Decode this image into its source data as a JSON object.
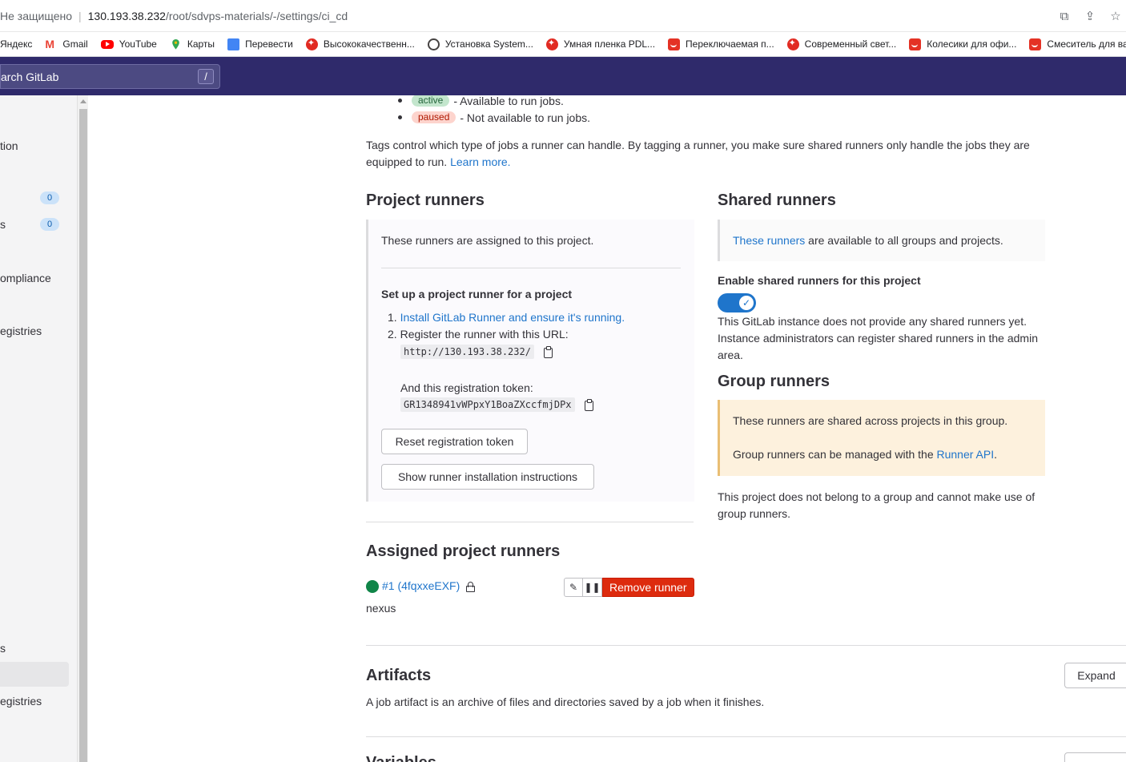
{
  "browser": {
    "secure_label": "Не защищено",
    "url_host": "130.193.38.232",
    "url_path": "/root/sdvps-materials/-/settings/ci_cd",
    "bookmarks": [
      {
        "label": "Яндекс",
        "icon": "yandex-icon"
      },
      {
        "label": "Gmail",
        "icon": "gmail-icon"
      },
      {
        "label": "YouTube",
        "icon": "youtube-icon"
      },
      {
        "label": "Карты",
        "icon": "maps-icon"
      },
      {
        "label": "Перевести",
        "icon": "translate-icon"
      },
      {
        "label": "Высококачественн...",
        "icon": "aliexpress-star-icon"
      },
      {
        "label": "Установка System...",
        "icon": "wordpress-icon"
      },
      {
        "label": "Умная пленка PDL...",
        "icon": "aliexpress-star-icon"
      },
      {
        "label": "Переключаемая п...",
        "icon": "aliexpress-bag-icon"
      },
      {
        "label": "Современный свет...",
        "icon": "aliexpress-star-icon"
      },
      {
        "label": "Колесики для офи...",
        "icon": "aliexpress-bag-icon"
      },
      {
        "label": "Смеситель для ва",
        "icon": "aliexpress-bag-icon"
      }
    ]
  },
  "header": {
    "search_placeholder": "arch GitLab",
    "search_shortcut": "/"
  },
  "sidebar": {
    "items": [
      {
        "label": "tion"
      },
      {
        "label": "",
        "count": "0"
      },
      {
        "label": "s",
        "count": "0"
      },
      {
        "label": "ompliance"
      },
      {
        "label": "egistries"
      },
      {
        "label": "s"
      },
      {
        "label": ""
      },
      {
        "label": "egistries"
      }
    ]
  },
  "main": {
    "statuses": [
      {
        "badge": "active",
        "text": "- Available to run jobs."
      },
      {
        "badge": "paused",
        "text": "- Not available to run jobs."
      }
    ],
    "tags_text": "Tags control which type of jobs a runner can handle. By tagging a runner, you make sure shared runners only handle the jobs they are equipped to run.",
    "learn_more": "Learn more.",
    "project_runners": {
      "title": "Project runners",
      "assigned_text": "These runners are assigned to this project.",
      "setup_title": "Set up a project runner for a project",
      "step1_link": "Install GitLab Runner and ensure it's running.",
      "step2_text": "Register the runner with this URL:",
      "url": "http://130.193.38.232/",
      "token_label": "And this registration token:",
      "token": "GR1348941vWPpxY1BoaZXccfmjDPx",
      "reset_button": "Reset registration token",
      "instructions_button": "Show runner installation instructions"
    },
    "shared_runners": {
      "title": "Shared runners",
      "link": "These runners",
      "text": "are available to all groups and projects.",
      "enable_label": "Enable shared runners for this project",
      "enabled": true,
      "note": "This GitLab instance does not provide any shared runners yet. Instance administrators can register shared runners in the admin area."
    },
    "group_runners": {
      "title": "Group runners",
      "shared_text": "These runners are shared across projects in this group.",
      "managed_text": "Group runners can be managed with the",
      "api_link": "Runner API",
      "note": "This project does not belong to a group and cannot make use of group runners."
    },
    "assigned": {
      "title": "Assigned project runners",
      "runner_link": "#1 (4fqxxeEXF)",
      "runner_desc": "nexus",
      "remove_button": "Remove runner"
    },
    "artifacts": {
      "title": "Artifacts",
      "text": "A job artifact is an archive of files and directories saved by a job when it finishes.",
      "expand_button": "Expand"
    },
    "next_section_title": "Variables"
  },
  "colors": {
    "header_bg": "#2f2a6b",
    "link": "#1f75cb",
    "danger": "#dd2b0e",
    "online": "#108548"
  }
}
